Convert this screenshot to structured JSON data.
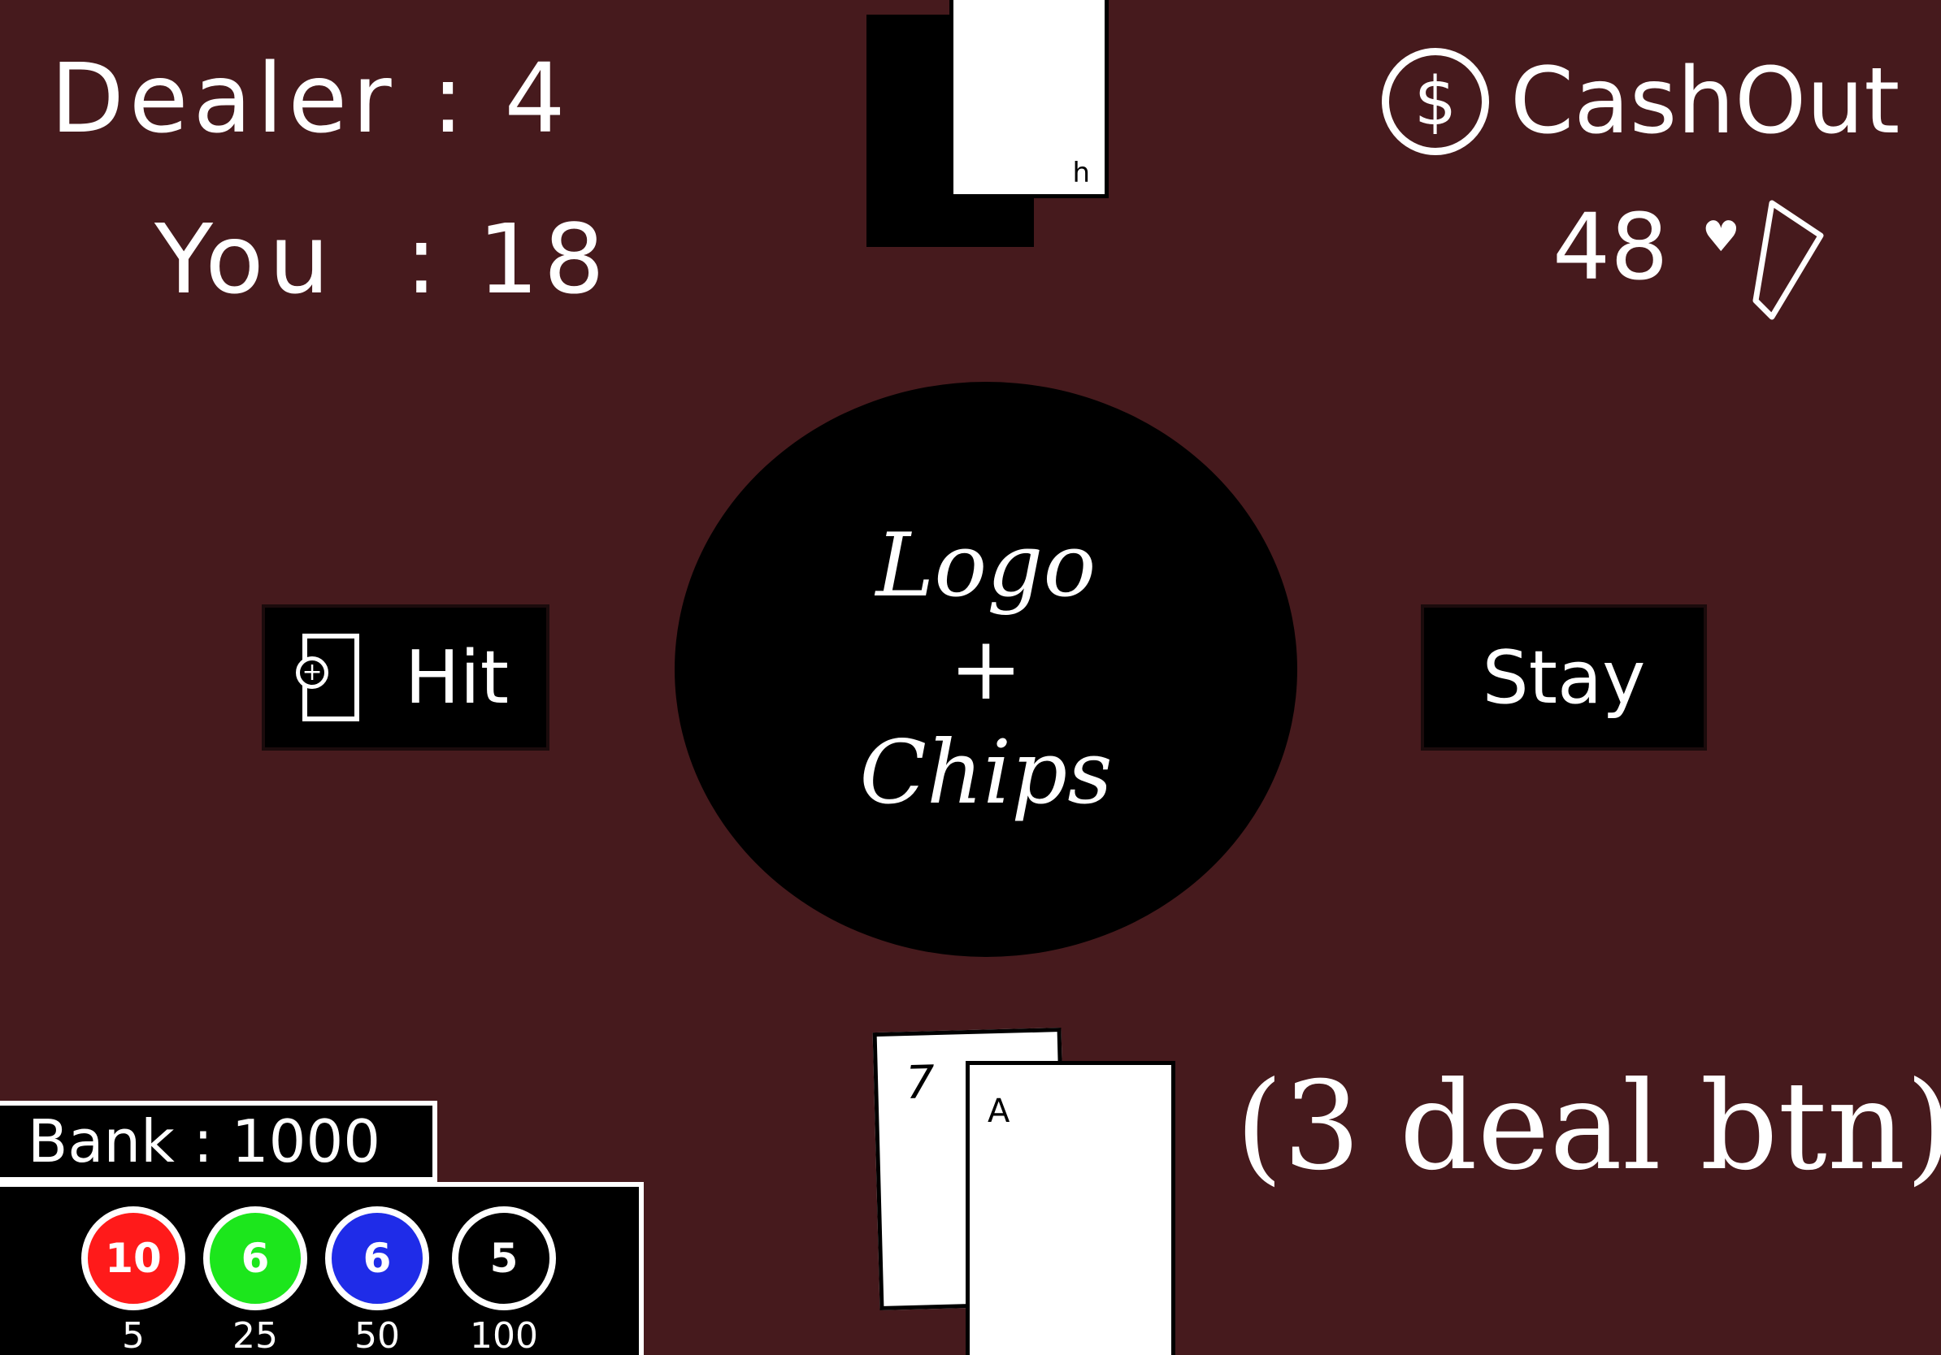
{
  "scores": {
    "dealer_label": "Dealer",
    "dealer_value": "4",
    "player_label": "You",
    "player_value": "18"
  },
  "cashout": {
    "icon_symbol": "$",
    "label": "CashOut"
  },
  "deck": {
    "count": "48",
    "icon": "heart-card-deck-icon",
    "heart_symbol": "♥"
  },
  "dealer_hand": {
    "visible_card": "h"
  },
  "logo": {
    "line1": "Logo",
    "line2": "+",
    "line3": "Chips"
  },
  "buttons": {
    "hit_label": "Hit",
    "hit_icon_symbol": "+",
    "stay_label": "Stay"
  },
  "player_hand": {
    "cards": [
      "7",
      "A"
    ]
  },
  "deal_hint": "(3 deal btn)",
  "bank": {
    "label": "Bank",
    "value": "1000"
  },
  "chips": [
    {
      "count": "10",
      "value": "5",
      "color": "#ff1a1a"
    },
    {
      "count": "6",
      "value": "25",
      "color": "#1ce61c"
    },
    {
      "count": "6",
      "value": "50",
      "color": "#1f2ce8"
    },
    {
      "count": "5",
      "value": "100",
      "color": "#000000"
    }
  ]
}
